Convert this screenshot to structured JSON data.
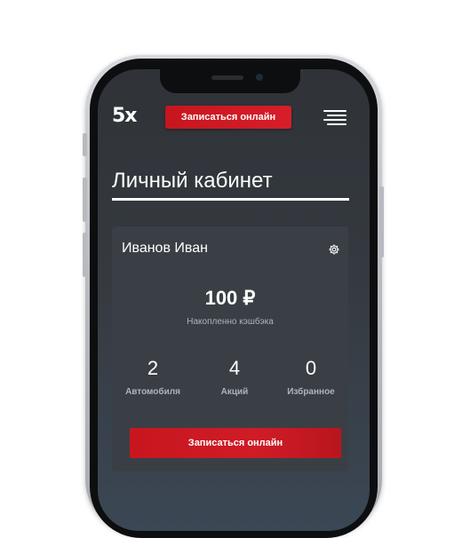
{
  "app": {
    "logo": "5x",
    "header_cta": "Записаться онлайн",
    "menu_icon": "hamburger-icon"
  },
  "page": {
    "title": "Личный кабинет"
  },
  "profile": {
    "name": "Иванов Иван",
    "settings_icon": "gear-icon",
    "cashback_amount": "100 ₽",
    "cashback_label": "Накопленно кэшбэка",
    "stats": [
      {
        "value": "2",
        "label": "Автомобиля"
      },
      {
        "value": "4",
        "label": "Акций"
      },
      {
        "value": "0",
        "label": "Избранное"
      }
    ],
    "cta": "Записаться онлайн"
  },
  "colors": {
    "accent": "#d71e2a",
    "screen_bg": "#33373c",
    "text": "#ffffff",
    "muted_text": "#aeb3b9"
  }
}
